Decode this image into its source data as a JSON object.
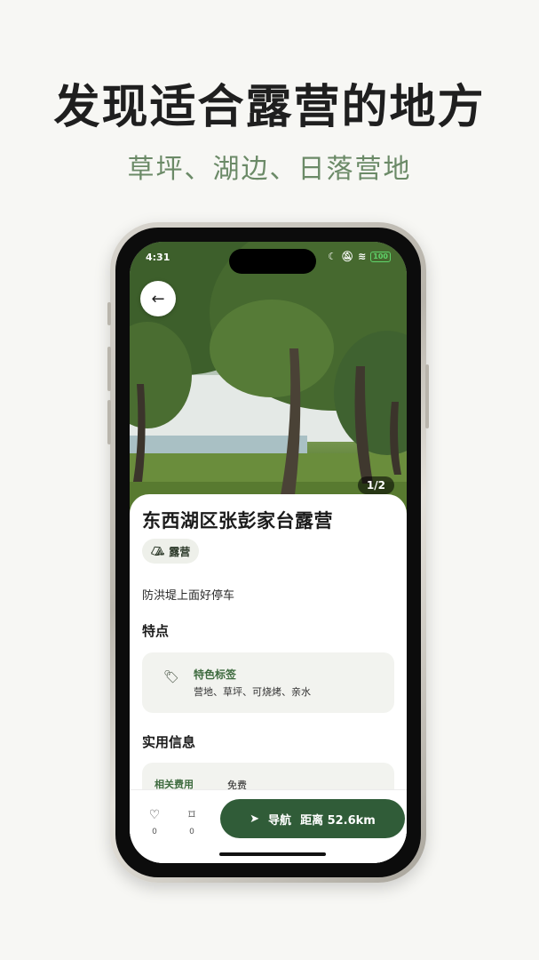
{
  "promo": {
    "headline": "发现适合露营的地方",
    "subline": "草坪、湖边、日落营地"
  },
  "status_bar": {
    "time": "4:31",
    "battery": "100"
  },
  "photo": {
    "counter": "1/2"
  },
  "place": {
    "name": "东西湖区张彭家台露营",
    "category_tag": "露营",
    "description": "防洪堤上面好停车"
  },
  "features": {
    "section_title": "特点",
    "card_heading": "特色标签",
    "card_value": "营地、草坪、可烧烤、亲水"
  },
  "practical_info": {
    "section_title": "实用信息",
    "rows": [
      {
        "label": "相关费用",
        "value": "免费"
      }
    ]
  },
  "bottom_bar": {
    "like_count": "0",
    "bookmark_count": "0",
    "nav_label": "导航",
    "distance_label": "距离 52.6km"
  },
  "colors": {
    "accent_green": "#305c38",
    "subtitle_green": "#6b8a67",
    "label_green": "#3e6b3f"
  },
  "icons": {
    "back": "arrow-left-icon",
    "tag": "tent-icon",
    "feature": "price-tag-icon",
    "like": "heart-icon",
    "bookmark": "bookmark-icon",
    "nav": "navigation-arrow-icon"
  }
}
